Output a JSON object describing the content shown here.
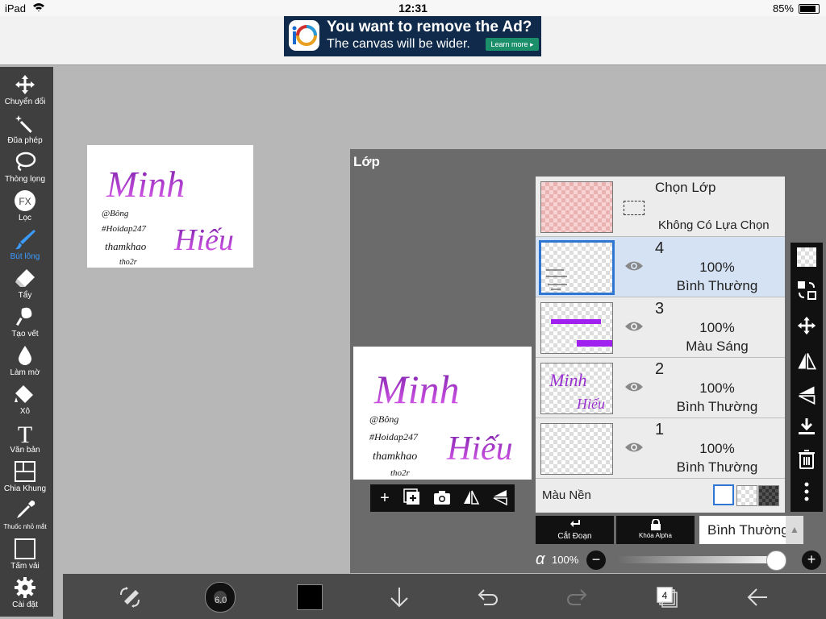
{
  "status": {
    "device": "iPad",
    "time": "12:31",
    "battery": "85%"
  },
  "ad": {
    "title": "You want to remove the Ad?",
    "subtitle": "The canvas will be wider.",
    "button": "Learn more ▸"
  },
  "tools": [
    {
      "label": "Chuyển đổi",
      "icon": "move-icon"
    },
    {
      "label": "Đũa phép",
      "icon": "magic-wand-icon"
    },
    {
      "label": "Thòng lọng",
      "icon": "lasso-icon"
    },
    {
      "label": "Lọc",
      "icon": "fx-icon"
    },
    {
      "label": "Bút lông",
      "icon": "brush-icon"
    },
    {
      "label": "Tẩy",
      "icon": "eraser-icon"
    },
    {
      "label": "Tạo vết",
      "icon": "smudge-icon"
    },
    {
      "label": "Làm mờ",
      "icon": "blur-icon"
    },
    {
      "label": "Xô",
      "icon": "bucket-icon"
    },
    {
      "label": "Văn bản",
      "icon": "text-icon"
    },
    {
      "label": "Chia Khung",
      "icon": "frame-divider-icon"
    },
    {
      "label": "Thuốc nhỏ mắt",
      "icon": "eyedropper-icon"
    },
    {
      "label": "Tấm vải",
      "icon": "canvas-icon"
    },
    {
      "label": "Cài đặt",
      "icon": "gear-icon"
    }
  ],
  "active_tool_color": "#3b9bff",
  "canvas_art": {
    "line1": "Minh",
    "line2": "Hiếu",
    "notes": [
      "@Bông",
      "#Hoidap247",
      "thamkhao",
      "tho2r"
    ]
  },
  "layers_panel": {
    "title": "Lớp",
    "selection": {
      "title": "Chọn Lớp",
      "subtitle": "Không Có Lựa Chọn"
    },
    "layers": [
      {
        "number": "4",
        "opacity": "100%",
        "blend": "Bình Thường",
        "selected": true
      },
      {
        "number": "3",
        "opacity": "100%",
        "blend": "Màu Sáng",
        "selected": false
      },
      {
        "number": "2",
        "opacity": "100%",
        "blend": "Bình Thường",
        "selected": false
      },
      {
        "number": "1",
        "opacity": "100%",
        "blend": "Bình Thường",
        "selected": false
      }
    ],
    "background_label": "Màu Nền",
    "clip_label": "Cắt Đoạn",
    "alpha_lock_label": "Khóa Alpha",
    "blend_mode_value": "Bình Thường",
    "alpha_symbol": "α",
    "alpha_value": "100%",
    "alpha_fraction": 1.0
  },
  "bottom": {
    "brush_size": "6.0",
    "layer_count": "4",
    "color": "#000000"
  }
}
